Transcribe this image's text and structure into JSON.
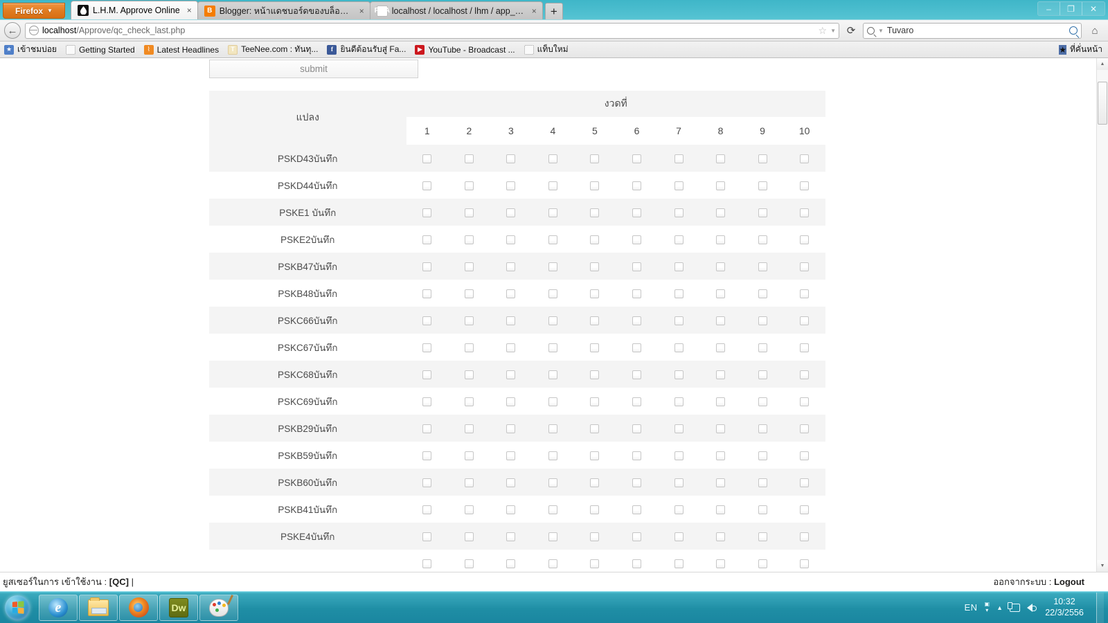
{
  "browser": {
    "app_button": "Firefox",
    "tabs": [
      {
        "title": "L.H.M. Approve Online",
        "icon": "droplet-icon",
        "active": true,
        "close": "×"
      },
      {
        "title": "Blogger: หน้าแดชบอร์ดของบล็อกเกอร์",
        "icon": "blogger-icon",
        "active": false,
        "close": "×"
      },
      {
        "title": "localhost / localhost / lhm / app_plot...",
        "icon": "phpmyadmin-icon",
        "active": false,
        "close": "×"
      }
    ],
    "new_tab_label": "+",
    "window_controls": {
      "minimize": "–",
      "restore": "❐",
      "close": "✕"
    },
    "url": {
      "host": "localhost",
      "path": "/Approve/qc_check_last.php"
    },
    "search": {
      "value": "Tuvaro",
      "engine": "Tuvaro"
    },
    "bookmarks": [
      {
        "label": "เข้าชมบ่อย",
        "icon": "most-visited-icon"
      },
      {
        "label": "Getting Started",
        "icon": "blank-page-icon"
      },
      {
        "label": "Latest Headlines",
        "icon": "rss-icon"
      },
      {
        "label": "TeeNee.com : ทันทุ...",
        "icon": "teenee-icon"
      },
      {
        "label": "ยินดีต้อนรับสู่ Fa...",
        "icon": "facebook-icon"
      },
      {
        "label": "YouTube - Broadcast ...",
        "icon": "youtube-icon"
      },
      {
        "label": "แท็บใหม่",
        "icon": "blank-page-icon"
      }
    ],
    "bookmarks_right": {
      "label": "ที่คั่นหน้า",
      "icon": "bookmarks-star-icon"
    }
  },
  "page": {
    "submit_label": "submit",
    "table": {
      "col_plot_header": "แปลง",
      "col_group_header": "งวดที่",
      "period_numbers": [
        "1",
        "2",
        "3",
        "4",
        "5",
        "6",
        "7",
        "8",
        "9",
        "10"
      ],
      "rows": [
        {
          "plot": "PSKD43บันทึก"
        },
        {
          "plot": "PSKD44บันทึก"
        },
        {
          "plot": "PSKE1 บันทึก"
        },
        {
          "plot": "PSKE2บันทึก"
        },
        {
          "plot": "PSKB47บันทึก"
        },
        {
          "plot": "PSKB48บันทึก"
        },
        {
          "plot": "PSKC66บันทึก"
        },
        {
          "plot": "PSKC67บันทึก"
        },
        {
          "plot": "PSKC68บันทึก"
        },
        {
          "plot": "PSKC69บันทึก"
        },
        {
          "plot": "PSKB29บันทึก"
        },
        {
          "plot": "PSKB59บันทึก"
        },
        {
          "plot": "PSKB60บันทึก"
        },
        {
          "plot": "PSKB41บันทึก"
        },
        {
          "plot": "PSKE4บันทึก"
        },
        {
          "plot": ""
        }
      ]
    },
    "footer": {
      "user_text": "ยูสเซอร์ในการ เข้าใช้งาน : ",
      "user_name": "[QC]",
      "user_suffix": " |",
      "logout_text": "ออกจากระบบ : ",
      "logout_link": "Logout"
    }
  },
  "taskbar": {
    "start_label": "start-orb",
    "items": [
      {
        "name": "internet-explorer",
        "glyph": "e"
      },
      {
        "name": "windows-explorer",
        "glyph": ""
      },
      {
        "name": "mozilla-firefox",
        "glyph": ""
      },
      {
        "name": "adobe-dreamweaver",
        "glyph": "Dw"
      },
      {
        "name": "microsoft-paint",
        "glyph": ""
      }
    ],
    "tray": {
      "language": "EN",
      "time": "10:32",
      "date": "22/3/2556"
    }
  }
}
